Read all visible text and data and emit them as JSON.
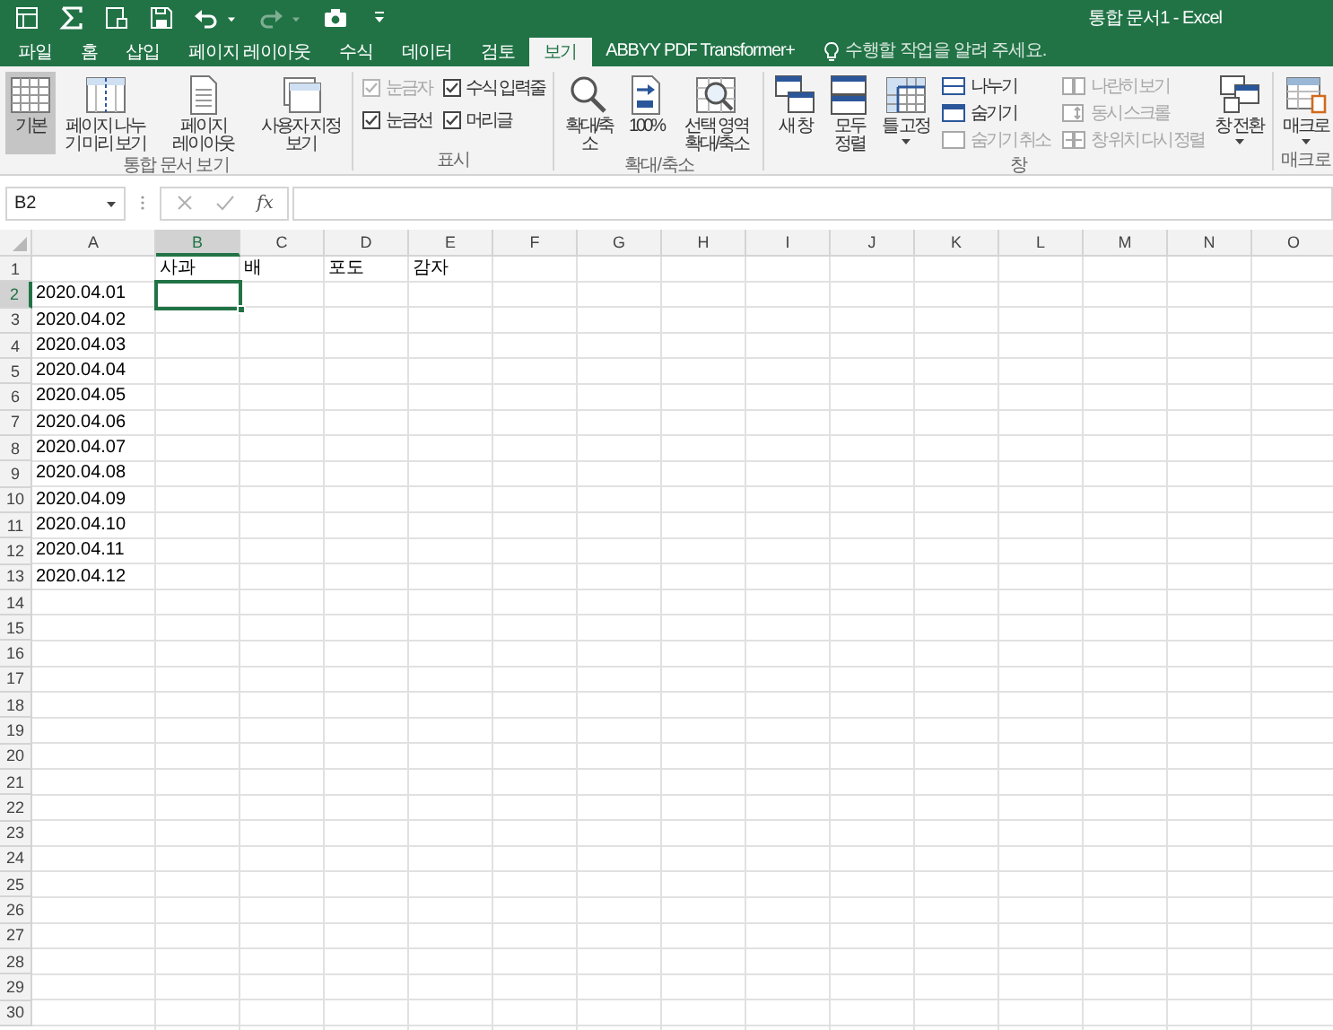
{
  "window": {
    "title": "통합 문서1 - Excel"
  },
  "tabs": [
    {
      "label": "파일",
      "selected": false
    },
    {
      "label": "홈",
      "selected": false
    },
    {
      "label": "삽입",
      "selected": false
    },
    {
      "label": "페이지 레이아웃",
      "selected": false
    },
    {
      "label": "수식",
      "selected": false
    },
    {
      "label": "데이터",
      "selected": false
    },
    {
      "label": "검토",
      "selected": false
    },
    {
      "label": "보기",
      "selected": true
    },
    {
      "label": "ABBYY PDF Transformer+",
      "selected": false
    }
  ],
  "tell_me": {
    "placeholder": "수행할 작업을 알려 주세요."
  },
  "ribbon": {
    "groups": [
      {
        "label": "통합 문서 보기",
        "items": [
          {
            "kind": "large",
            "label": "기본",
            "selected": true,
            "dropdown": false
          },
          {
            "kind": "large",
            "label": "페이지 나누기 미리 보기",
            "selected": false,
            "dropdown": false
          },
          {
            "kind": "large",
            "label": "페이지 레이아웃",
            "selected": false,
            "dropdown": false
          },
          {
            "kind": "large",
            "label": "사용자 지정 보기",
            "selected": false,
            "dropdown": false
          }
        ]
      },
      {
        "label": "표시",
        "items": [
          {
            "kind": "stack",
            "items": [
              {
                "kind": "check",
                "label": "눈금자",
                "checked": true,
                "disabled": true
              },
              {
                "kind": "check",
                "label": "눈금선",
                "checked": true,
                "disabled": false
              }
            ]
          },
          {
            "kind": "stack",
            "items": [
              {
                "kind": "check",
                "label": "수식 입력줄",
                "checked": true,
                "disabled": false
              },
              {
                "kind": "check",
                "label": "머리글",
                "checked": true,
                "disabled": false
              }
            ]
          }
        ]
      },
      {
        "label": "확대/축소",
        "items": [
          {
            "kind": "large",
            "label": "확대/축소",
            "dropdown": false
          },
          {
            "kind": "large",
            "label": "100%",
            "dropdown": false
          },
          {
            "kind": "large",
            "label": "선택 영역 확대/축소",
            "dropdown": false
          }
        ]
      },
      {
        "label": "창",
        "items": [
          {
            "kind": "large",
            "label": "새 창",
            "dropdown": false
          },
          {
            "kind": "large",
            "label": "모두 정렬",
            "dropdown": false
          },
          {
            "kind": "large",
            "label": "틀 고정",
            "dropdown": true
          },
          {
            "kind": "stack",
            "items": [
              {
                "kind": "small",
                "label": "나누기",
                "disabled": false
              },
              {
                "kind": "small",
                "label": "숨기기",
                "disabled": false
              },
              {
                "kind": "small",
                "label": "숨기기 취소",
                "disabled": true
              }
            ]
          },
          {
            "kind": "stack",
            "items": [
              {
                "kind": "small",
                "label": "나란히 보기",
                "disabled": true
              },
              {
                "kind": "small",
                "label": "동시 스크롤",
                "disabled": true
              },
              {
                "kind": "small",
                "label": "창 위치 다시 정렬",
                "disabled": true
              }
            ]
          },
          {
            "kind": "large",
            "label": "창 전환",
            "dropdown": true
          }
        ]
      },
      {
        "label": "매크로",
        "items": [
          {
            "kind": "large",
            "label": "매크로",
            "dropdown": true
          }
        ]
      }
    ]
  },
  "name_box": {
    "value": "B2"
  },
  "formula_bar": {
    "function_label": "fx"
  },
  "sheet": {
    "columns": [
      {
        "label": "A",
        "selected": false
      },
      {
        "label": "B",
        "selected": true
      },
      {
        "label": "C",
        "selected": false
      },
      {
        "label": "D",
        "selected": false
      },
      {
        "label": "E",
        "selected": false
      },
      {
        "label": "F",
        "selected": false
      },
      {
        "label": "G",
        "selected": false
      },
      {
        "label": "H",
        "selected": false
      },
      {
        "label": "I",
        "selected": false
      },
      {
        "label": "J",
        "selected": false
      },
      {
        "label": "K",
        "selected": false
      },
      {
        "label": "L",
        "selected": false
      },
      {
        "label": "M",
        "selected": false
      },
      {
        "label": "N",
        "selected": false
      },
      {
        "label": "O",
        "selected": false
      }
    ],
    "rows": [
      {
        "label": "1",
        "selected": false,
        "cells": [
          null,
          "사과",
          "배",
          "포도",
          "감자"
        ]
      },
      {
        "label": "2",
        "selected": true,
        "cells": [
          "2020.04.01"
        ]
      },
      {
        "label": "3",
        "selected": false,
        "cells": [
          "2020.04.02"
        ]
      },
      {
        "label": "4",
        "selected": false,
        "cells": [
          "2020.04.03"
        ]
      },
      {
        "label": "5",
        "selected": false,
        "cells": [
          "2020.04.04"
        ]
      },
      {
        "label": "6",
        "selected": false,
        "cells": [
          "2020.04.05"
        ]
      },
      {
        "label": "7",
        "selected": false,
        "cells": [
          "2020.04.06"
        ]
      },
      {
        "label": "8",
        "selected": false,
        "cells": [
          "2020.04.07"
        ]
      },
      {
        "label": "9",
        "selected": false,
        "cells": [
          "2020.04.08"
        ]
      },
      {
        "label": "10",
        "selected": false,
        "cells": [
          "2020.04.09"
        ]
      },
      {
        "label": "11",
        "selected": false,
        "cells": [
          "2020.04.10"
        ]
      },
      {
        "label": "12",
        "selected": false,
        "cells": [
          "2020.04.11"
        ]
      },
      {
        "label": "13",
        "selected": false,
        "cells": [
          "2020.04.12"
        ]
      },
      {
        "label": "14",
        "selected": false
      },
      {
        "label": "15",
        "selected": false
      },
      {
        "label": "16",
        "selected": false
      },
      {
        "label": "17",
        "selected": false
      },
      {
        "label": "18",
        "selected": false
      },
      {
        "label": "19",
        "selected": false
      },
      {
        "label": "20",
        "selected": false
      },
      {
        "label": "21",
        "selected": false
      },
      {
        "label": "22",
        "selected": false
      },
      {
        "label": "23",
        "selected": false
      },
      {
        "label": "24",
        "selected": false
      },
      {
        "label": "25",
        "selected": false
      },
      {
        "label": "26",
        "selected": false
      },
      {
        "label": "27",
        "selected": false
      },
      {
        "label": "28",
        "selected": false
      },
      {
        "label": "29",
        "selected": false
      },
      {
        "label": "30",
        "selected": false
      }
    ]
  }
}
